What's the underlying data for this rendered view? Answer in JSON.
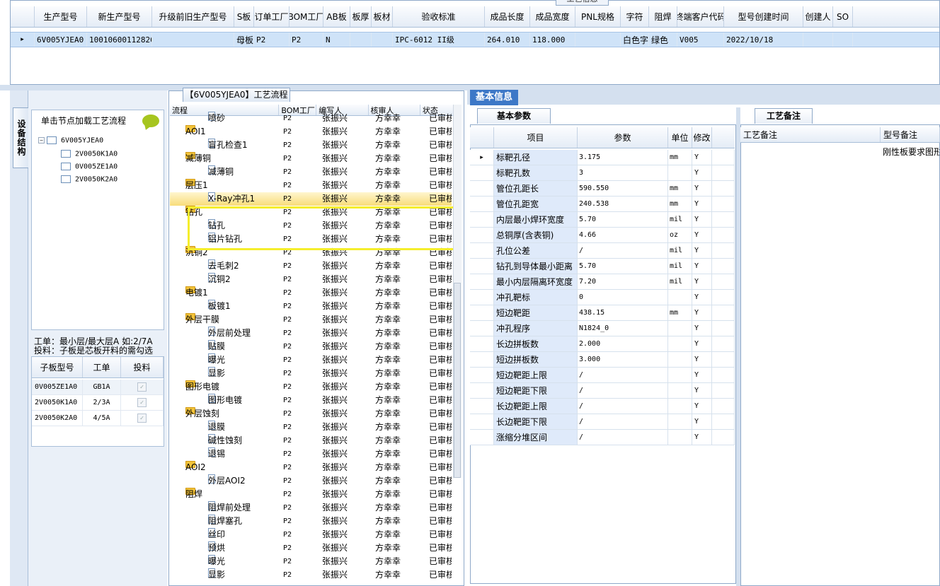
{
  "top_tab": "工艺信息",
  "top_columns": [
    "生产型号",
    "新生产型号",
    "升级前旧生产型号",
    "S板",
    "订单工厂",
    "BOM工厂",
    "AB板",
    "板厚",
    "板材",
    "验收标准",
    "成品长度",
    "成品宽度",
    "PNL规格",
    "字符",
    "阻焊",
    "终端客户代码",
    "型号创建时间",
    "创建人",
    "SO"
  ],
  "top_row": [
    "6V005YJEA0",
    "10010600112826",
    "",
    "母板",
    "P2",
    "P2",
    "N",
    "",
    "",
    "IPC-6012 II级",
    "264.010",
    "118.000",
    "",
    "白色字符",
    "绿色",
    "V005",
    "2022/10/18",
    "",
    ""
  ],
  "left_vtab": "设备结构",
  "left_title": "单击节点加载工艺流程",
  "tree_root": "6V005YJEA0",
  "tree_children": [
    "2V0050K1A0",
    "0V005ZE1A0",
    "2V0050K2A0"
  ],
  "hint_line1": "工单：最小层/最大层A 如:2/7A",
  "hint_line2": "投料：子板是芯板开料的需勾选",
  "sub_columns": [
    "子板型号",
    "工单",
    "投料"
  ],
  "sub_rows": [
    {
      "model": "0V005ZE1A0",
      "order": "GB1A",
      "checked": true
    },
    {
      "model": "2V0050K1A0",
      "order": "2/3A",
      "checked": true
    },
    {
      "model": "2V0050K2A0",
      "order": "4/5A",
      "checked": true
    }
  ],
  "mid_tab": "【6V005YJEA0】工艺流程",
  "mid_columns": [
    "流程",
    "BOM工厂",
    "编写人",
    "核审人",
    "状态"
  ],
  "process_rows": [
    {
      "kind": "doc",
      "name": "喷砂"
    },
    {
      "kind": "folder",
      "name": "AOI1"
    },
    {
      "kind": "doc",
      "name": "盲孔检查1"
    },
    {
      "kind": "folder",
      "name": "减薄铜"
    },
    {
      "kind": "doc",
      "name": "减薄铜"
    },
    {
      "kind": "folder",
      "name": "层压1"
    },
    {
      "kind": "doc",
      "name": "X-Ray冲孔1",
      "selected": true
    },
    {
      "kind": "folder",
      "name": "钻孔"
    },
    {
      "kind": "doc",
      "name": "钻孔"
    },
    {
      "kind": "doc",
      "name": "铝片钻孔"
    },
    {
      "kind": "folder",
      "name": "沉铜2"
    },
    {
      "kind": "doc",
      "name": "去毛刺2"
    },
    {
      "kind": "doc",
      "name": "沉铜2"
    },
    {
      "kind": "folder",
      "name": "电镀1"
    },
    {
      "kind": "doc",
      "name": "板镀1"
    },
    {
      "kind": "folder",
      "name": "外层干膜"
    },
    {
      "kind": "doc",
      "name": "外层前处理"
    },
    {
      "kind": "doc",
      "name": "贴膜"
    },
    {
      "kind": "doc",
      "name": "曝光"
    },
    {
      "kind": "doc",
      "name": "显影"
    },
    {
      "kind": "folder",
      "name": "图形电镀"
    },
    {
      "kind": "doc",
      "name": "图形电镀"
    },
    {
      "kind": "folder",
      "name": "外层蚀刻"
    },
    {
      "kind": "doc",
      "name": "退膜"
    },
    {
      "kind": "doc",
      "name": "碱性蚀刻"
    },
    {
      "kind": "doc",
      "name": "退锡"
    },
    {
      "kind": "folder",
      "name": "AOI2"
    },
    {
      "kind": "doc",
      "name": "外层AOI2"
    },
    {
      "kind": "folder",
      "name": "阻焊"
    },
    {
      "kind": "doc",
      "name": "阻焊前处理"
    },
    {
      "kind": "doc",
      "name": "阻焊塞孔"
    },
    {
      "kind": "doc",
      "name": "丝印"
    },
    {
      "kind": "doc",
      "name": "预烘"
    },
    {
      "kind": "doc",
      "name": "曝光"
    },
    {
      "kind": "doc",
      "name": "显影"
    }
  ],
  "process_common": {
    "bom": "P2",
    "writer": "张振兴",
    "reviewer": "方幸幸",
    "status": "已审核"
  },
  "right_tab": "基本信息",
  "param_subtab": "基本参数",
  "notes_subtab": "工艺备注",
  "param_columns": [
    "项目",
    "参数",
    "单位",
    "修改"
  ],
  "params": [
    {
      "name": "标靶孔径",
      "value": "3.175",
      "unit": "mm",
      "mod": "Y"
    },
    {
      "name": "标靶孔数",
      "value": "3",
      "unit": "",
      "mod": "Y"
    },
    {
      "name": "管位孔距长",
      "value": "590.550",
      "unit": "mm",
      "mod": "Y"
    },
    {
      "name": "管位孔距宽",
      "value": "240.538",
      "unit": "mm",
      "mod": "Y"
    },
    {
      "name": "内层最小焊环宽度",
      "value": "5.70",
      "unit": "mil",
      "mod": "Y"
    },
    {
      "name": "总铜厚(含表铜)",
      "value": "4.66",
      "unit": "oz",
      "mod": "Y"
    },
    {
      "name": "孔位公差",
      "value": "/",
      "unit": "mil",
      "mod": "Y"
    },
    {
      "name": "钻孔到导体最小距离",
      "value": "5.70",
      "unit": "mil",
      "mod": "Y"
    },
    {
      "name": "最小内层隔离环宽度",
      "value": "7.20",
      "unit": "mil",
      "mod": "Y"
    },
    {
      "name": "冲孔靶标",
      "value": "0",
      "unit": "",
      "mod": "Y"
    },
    {
      "name": "短边靶距",
      "value": "438.15",
      "unit": "mm",
      "mod": "Y"
    },
    {
      "name": "冲孔程序",
      "value": "N1824_0",
      "unit": "",
      "mod": "Y"
    },
    {
      "name": "长边拼板数",
      "value": "2.000",
      "unit": "",
      "mod": "Y"
    },
    {
      "name": "短边拼板数",
      "value": "3.000",
      "unit": "",
      "mod": "Y"
    },
    {
      "name": "短边靶距上限",
      "value": "/",
      "unit": "",
      "mod": "Y"
    },
    {
      "name": "短边靶距下限",
      "value": "/",
      "unit": "",
      "mod": "Y"
    },
    {
      "name": "长边靶距上限",
      "value": "/",
      "unit": "",
      "mod": "Y"
    },
    {
      "name": "长边靶距下限",
      "value": "/",
      "unit": "",
      "mod": "Y"
    },
    {
      "name": "涨缩分堆区间",
      "value": "/",
      "unit": "",
      "mod": "Y"
    }
  ],
  "notes_columns": [
    "工艺备注",
    "型号备注"
  ],
  "notes_row": [
    "",
    "刚性板要求图形"
  ]
}
